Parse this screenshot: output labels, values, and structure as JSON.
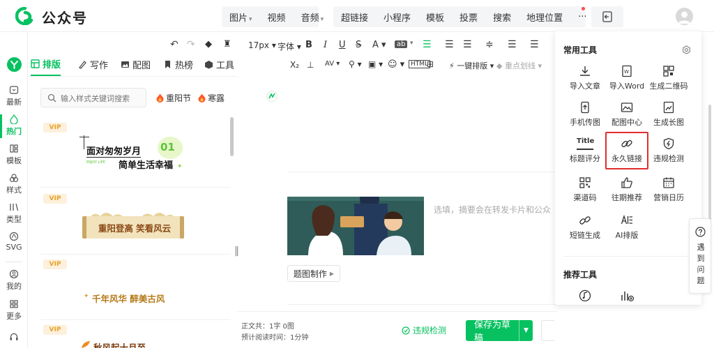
{
  "app": {
    "title": "公众号"
  },
  "topbar": {
    "menu_group1": [
      {
        "label": "图片",
        "dropdown": true
      },
      {
        "label": "视频",
        "dropdown": false
      },
      {
        "label": "音频",
        "dropdown": true
      }
    ],
    "menu_group2": [
      {
        "label": "超链接"
      },
      {
        "label": "小程序"
      },
      {
        "label": "模板"
      },
      {
        "label": "投票"
      },
      {
        "label": "搜索"
      },
      {
        "label": "地理位置"
      },
      {
        "label": "···"
      }
    ]
  },
  "leftnav": {
    "items": [
      {
        "label": "最新",
        "icon": "new-icon"
      },
      {
        "label": "热门",
        "icon": "fire-icon",
        "active": true
      },
      {
        "label": "模板",
        "icon": "template-icon"
      },
      {
        "label": "样式",
        "icon": "style-icon"
      },
      {
        "label": "类型",
        "icon": "type-icon"
      },
      {
        "label": "SVG",
        "icon": "svg-icon"
      },
      {
        "label": "我的",
        "icon": "user-icon"
      },
      {
        "label": "更多",
        "icon": "more-icon"
      }
    ]
  },
  "style_panel": {
    "tabs": [
      {
        "label": "排版",
        "icon": "layout-icon",
        "active": true
      },
      {
        "label": "写作",
        "icon": "pen-icon"
      },
      {
        "label": "配图",
        "icon": "image-icon"
      },
      {
        "label": "热榜",
        "icon": "bookmark-icon"
      },
      {
        "label": "工具",
        "icon": "cube-icon"
      }
    ],
    "search": {
      "placeholder": "输入样式关键词搜索"
    },
    "hot_tags": [
      "重阳节",
      "寒露"
    ],
    "vip_label": "VIP",
    "cards": [
      {
        "line1": "面对匆匆岁月",
        "line2": "简单生活幸福",
        "num": "01",
        "sub": "ENJOY LIFE"
      },
      {
        "text": "重阳登高 笑看风云"
      },
      {
        "text": "千年风华 醉美古风"
      },
      {
        "text": "秋风起十月至"
      }
    ]
  },
  "editor": {
    "toolbar": {
      "font_size": "17px",
      "font_family": "字体",
      "one_click": "一键排版",
      "highlight": "重点划线"
    },
    "cover_caption": "选填，摘要会在转发卡片和公众",
    "cover_button": "题图制作",
    "stats": {
      "line1_label": "正文共：",
      "line1_value": "1字 0图",
      "line2_label": "预计阅读时间：",
      "line2_value": "1分钟"
    },
    "check_label": "违规检测",
    "save_label": "保存为草稿"
  },
  "tools_panel": {
    "title": "常用工具",
    "tools": [
      {
        "label": "导入文章",
        "icon": "download-icon"
      },
      {
        "label": "导入Word",
        "icon": "word-icon"
      },
      {
        "label": "生成二维码",
        "icon": "qrcode-icon"
      },
      {
        "label": "手机传图",
        "icon": "phone-upload-icon"
      },
      {
        "label": "配图中心",
        "icon": "picture-icon"
      },
      {
        "label": "生成长图",
        "icon": "long-image-icon"
      },
      {
        "label": "标题评分",
        "icon": "title-score-icon"
      },
      {
        "label": "永久链接",
        "icon": "link-icon"
      },
      {
        "label": "违规检测",
        "icon": "shield-icon"
      },
      {
        "label": "渠道码",
        "icon": "channel-code-icon"
      },
      {
        "label": "往期推荐",
        "icon": "thumb-up-icon"
      },
      {
        "label": "营销日历",
        "icon": "calendar-icon"
      },
      {
        "label": "短链生成",
        "icon": "short-link-icon"
      },
      {
        "label": "AI排版",
        "icon": "ai-layout-icon"
      }
    ],
    "recommend_title": "推荐工具"
  },
  "help": {
    "label": "遇到问题"
  },
  "colors": {
    "accent": "#07c160",
    "highlight_border": "#e02d2d",
    "vip": "#e8a22e"
  }
}
